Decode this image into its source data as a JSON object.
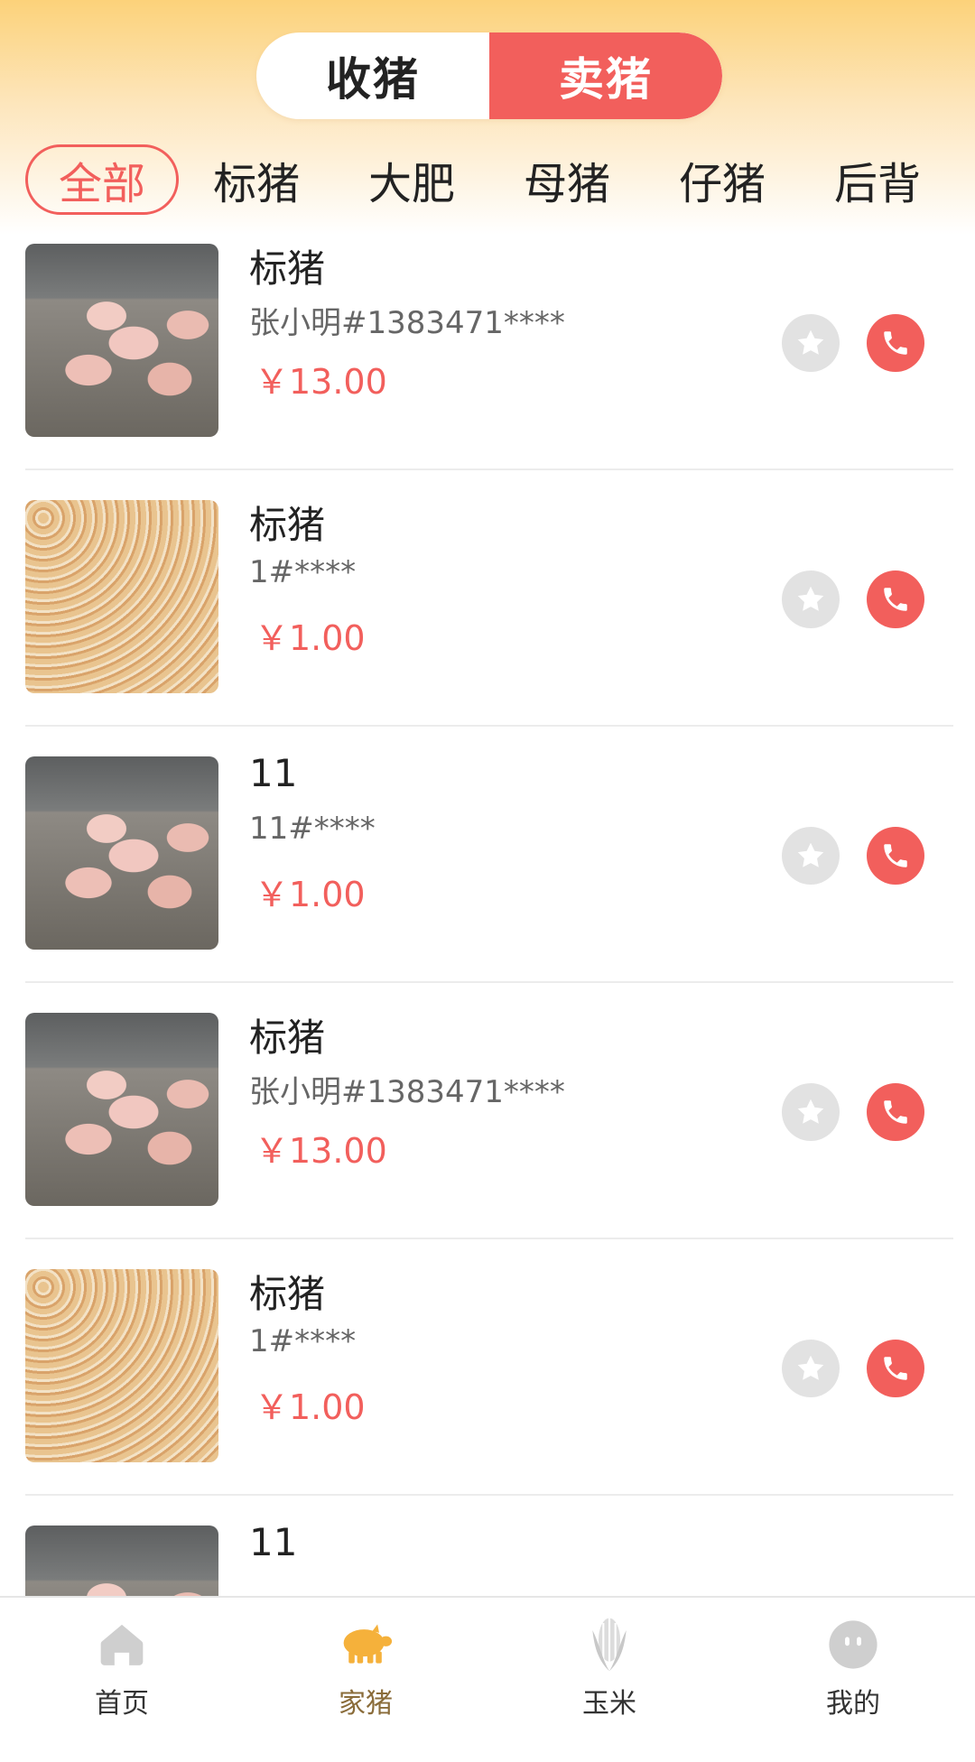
{
  "header": {
    "segments": [
      {
        "label": "收猪",
        "active": false
      },
      {
        "label": "卖猪",
        "active": true
      }
    ]
  },
  "categories": [
    {
      "label": "全部",
      "active": true
    },
    {
      "label": "标猪",
      "active": false
    },
    {
      "label": "大肥",
      "active": false
    },
    {
      "label": "母猪",
      "active": false
    },
    {
      "label": "仔猪",
      "active": false
    },
    {
      "label": "后背",
      "active": false
    }
  ],
  "listings": [
    {
      "title": "标猪",
      "seller": "张小明#1383471****",
      "price": "￥13.00",
      "image": "pig-pen-photo"
    },
    {
      "title": "标猪",
      "seller": "1#****",
      "price": "￥1.00",
      "image": "corn-kernels-photo"
    },
    {
      "title": "11",
      "seller": "11#****",
      "price": "￥1.00",
      "image": "pig-pen-photo"
    },
    {
      "title": "标猪",
      "seller": "张小明#1383471****",
      "price": "￥13.00",
      "image": "pig-pen-photo"
    },
    {
      "title": "标猪",
      "seller": "1#****",
      "price": "￥1.00",
      "image": "corn-kernels-photo"
    },
    {
      "title": "11",
      "seller": "",
      "price": "",
      "image": "pig-pen-photo"
    }
  ],
  "tabbar": [
    {
      "label": "首页",
      "icon": "home-icon",
      "active": false
    },
    {
      "label": "家猪",
      "icon": "pig-icon",
      "active": true
    },
    {
      "label": "玉米",
      "icon": "corn-icon",
      "active": false
    },
    {
      "label": "我的",
      "icon": "profile-icon",
      "active": false
    }
  ],
  "colors": {
    "accent": "#f25f5c",
    "header_gradient_top": "#fcd27a",
    "tab_active_icon": "#f5b13b",
    "tab_inactive_icon": "#cfcfcf"
  }
}
